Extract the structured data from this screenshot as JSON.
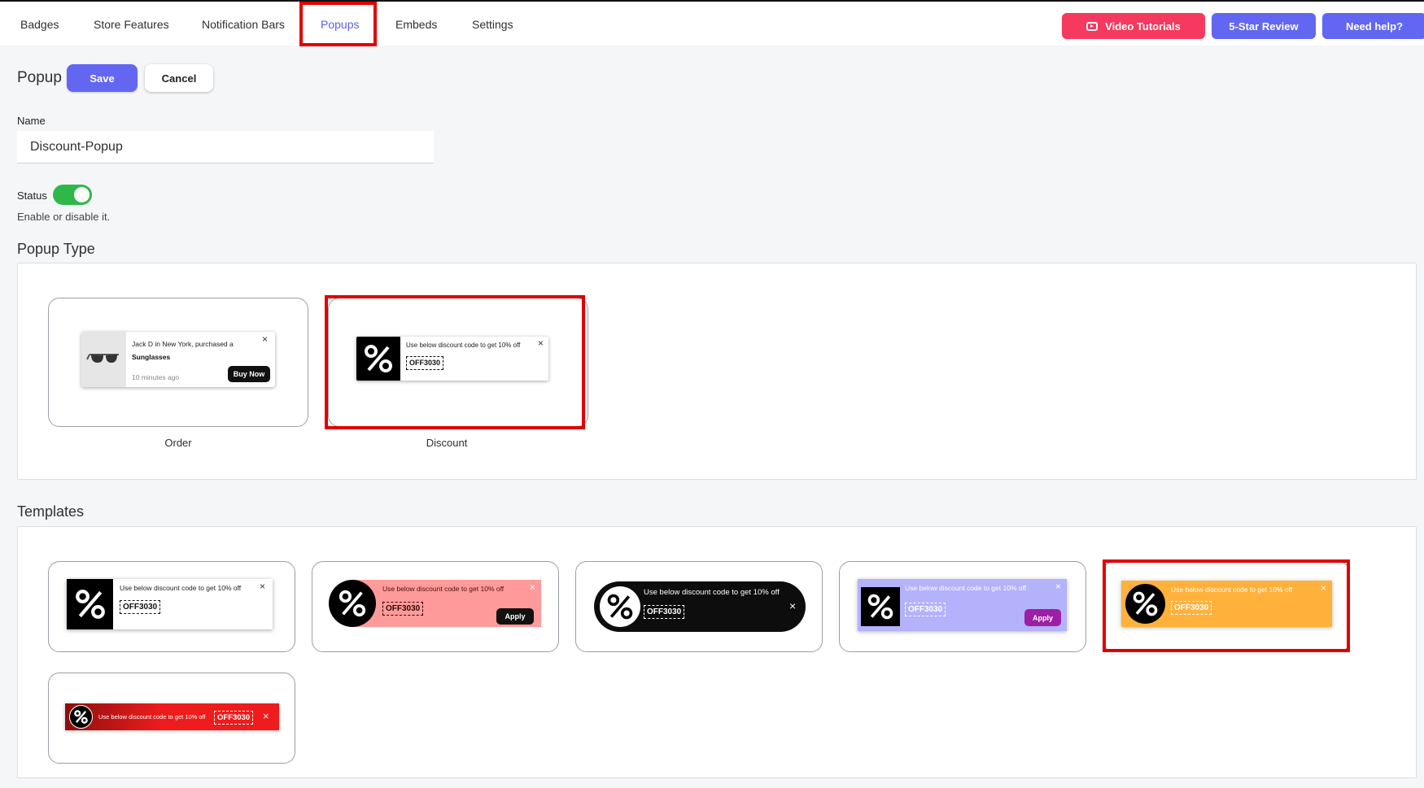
{
  "nav": {
    "tabs": [
      "Badges",
      "Store Features",
      "Notification Bars",
      "Popups",
      "Embeds",
      "Settings"
    ],
    "active": "Popups",
    "video_tutorials": "Video Tutorials",
    "review": "5-Star Review",
    "help": "Need help?"
  },
  "header": {
    "title": "Popup",
    "save": "Save",
    "cancel": "Cancel"
  },
  "form": {
    "name_label": "Name",
    "name_value": "Discount-Popup",
    "status_label": "Status",
    "status_on": true,
    "status_hint": "Enable or disable it."
  },
  "popup_type": {
    "title": "Popup Type",
    "order": {
      "label": "Order",
      "message": "Jack D in New York, purchased a",
      "product": "Sunglasses",
      "time": "10 minutes ago",
      "button": "Buy Now"
    },
    "discount": {
      "label": "Discount",
      "message": "Use below discount code to get 10% off",
      "code": "OFF3030"
    }
  },
  "templates": {
    "title": "Templates",
    "message": "Use below discount code to get 10% off",
    "code": "OFF3030",
    "apply": "Apply",
    "close": "×",
    "colors": {
      "t1": "#ffffff",
      "t2": "#ff9a9a",
      "t3": "#0d0d0d",
      "t4": "#b4b2fb",
      "t5": "#ffb13c",
      "t6": "#ee1c1c",
      "apply_purple": "#9c1fa6",
      "highlight": "#e10000"
    }
  }
}
